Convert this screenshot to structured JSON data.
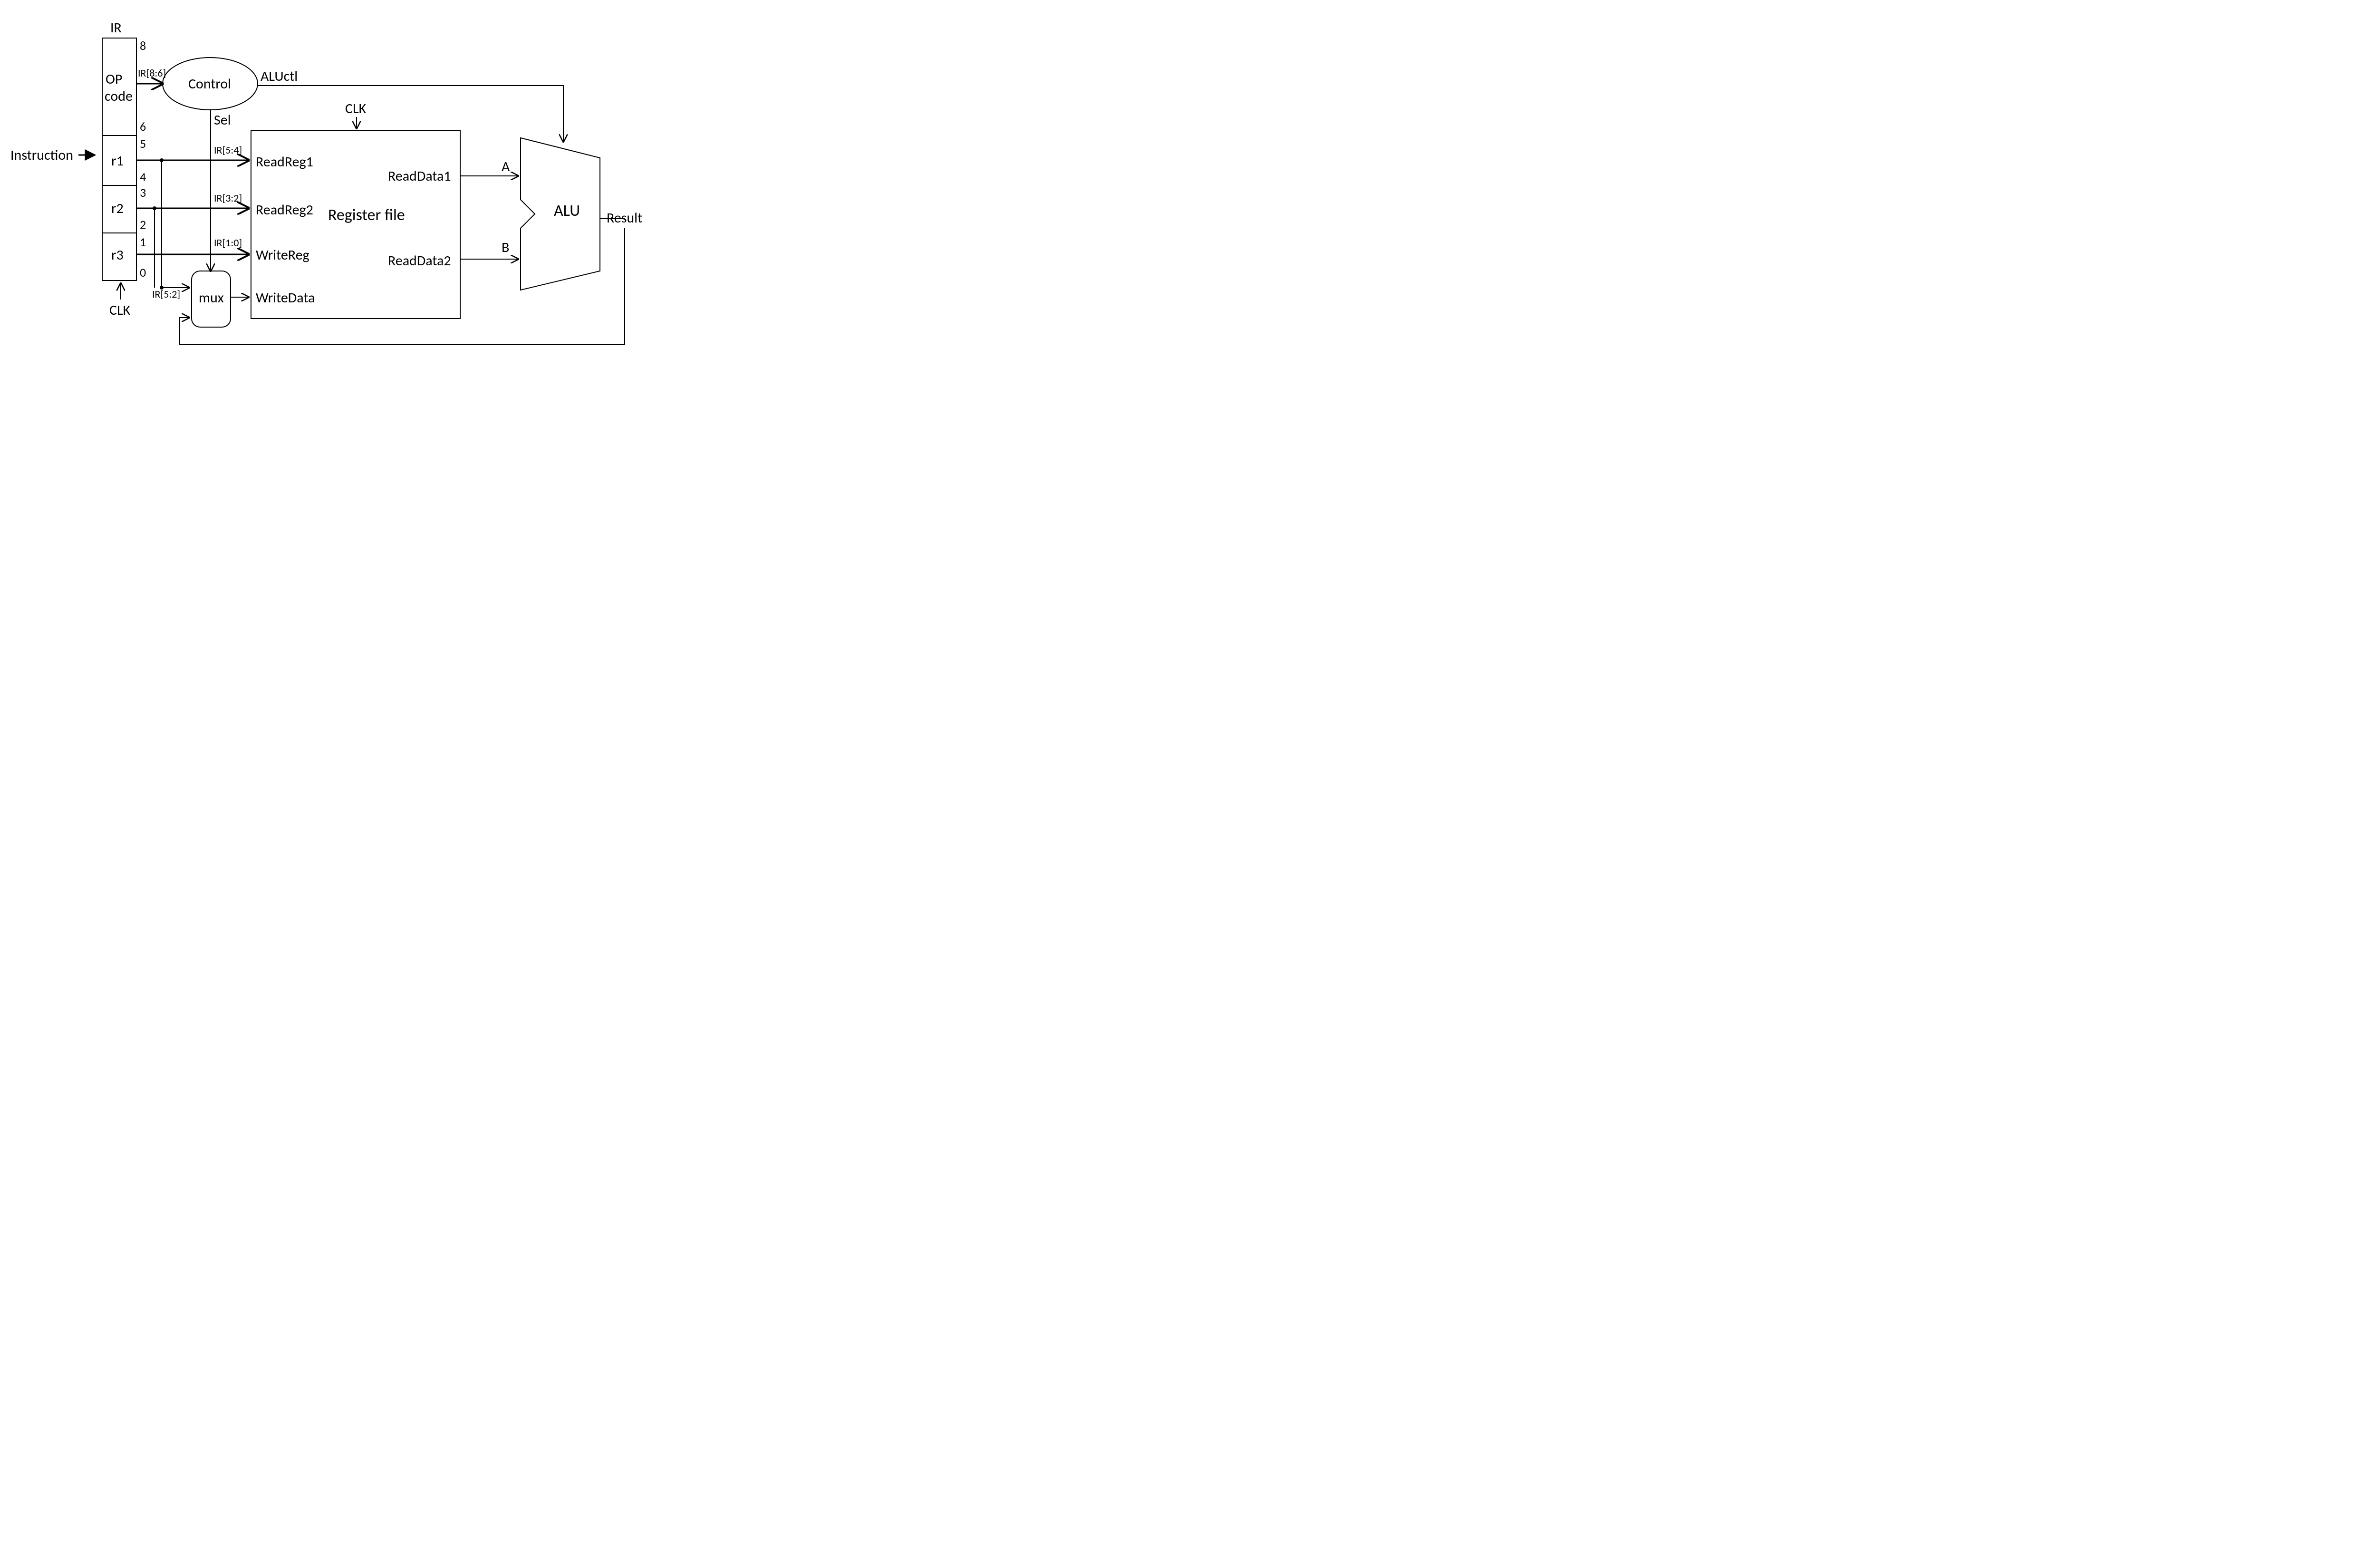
{
  "ir": {
    "title": "IR",
    "fields": {
      "opcode_l1": "OP",
      "opcode_l2": "code",
      "r1": "r1",
      "r2": "r2",
      "r3": "r3"
    },
    "bits": {
      "b8": "8",
      "b6": "6",
      "b5": "5",
      "b4": "4",
      "b3": "3",
      "b2": "2",
      "b1": "1",
      "b0": "0"
    },
    "clk": "CLK",
    "instruction": "Instruction"
  },
  "bus": {
    "ir86": "IR[8:6]",
    "ir54": "IR[5:4]",
    "ir32": "IR[3:2]",
    "ir10": "IR[1:0]",
    "ir52": "IR[5:2]"
  },
  "control": {
    "label": "Control",
    "sel": "Sel",
    "aluctl": "ALUctl"
  },
  "mux": {
    "label": "mux"
  },
  "regfile": {
    "title": "Register file",
    "clk": "CLK",
    "readreg1": "ReadReg1",
    "readreg2": "ReadReg2",
    "writereg": "WriteReg",
    "writedata": "WriteData",
    "readdata1": "ReadData1",
    "readdata2": "ReadData2"
  },
  "alu": {
    "label": "ALU",
    "a": "A",
    "b": "B",
    "result": "Result"
  }
}
